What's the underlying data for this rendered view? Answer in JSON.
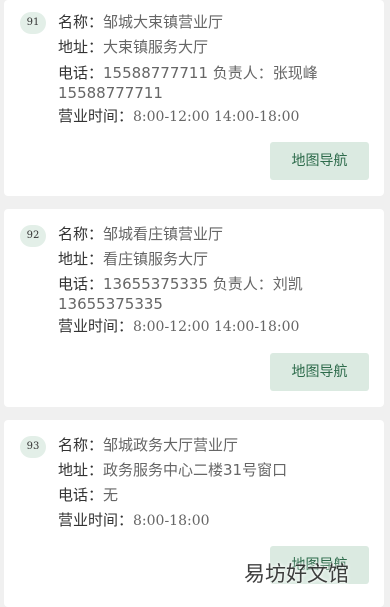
{
  "labels": {
    "name": "名称：",
    "address": "地址：",
    "phone": "电话：",
    "hours": "营业时间："
  },
  "cards": [
    {
      "index": "91",
      "name": "邹城大束镇营业厅",
      "address": "大束镇服务大厅",
      "phone": "15588777711 负责人：张现峰 15588777711",
      "hours": "8:00-12:00 14:00-18:00",
      "button": "地图导航"
    },
    {
      "index": "92",
      "name": "邹城看庄镇营业厅",
      "address": "看庄镇服务大厅",
      "phone": "13655375335 负责人：刘凯 13655375335",
      "hours": "8:00-12:00 14:00-18:00",
      "button": "地图导航"
    },
    {
      "index": "93",
      "name": "邹城政务大厅营业厅",
      "address": "政务服务中心二楼31号窗口",
      "phone": "无",
      "hours": "8:00-18:00",
      "button": "地图导航"
    }
  ],
  "watermark": "易坊好文馆"
}
